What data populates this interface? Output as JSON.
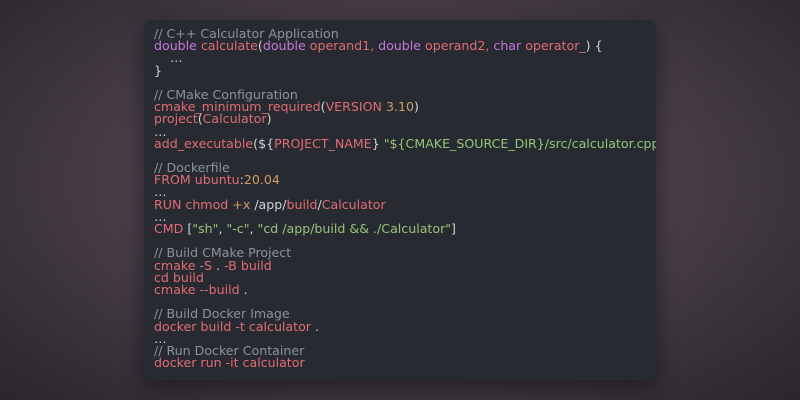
{
  "colors": {
    "comment": "#8c929c",
    "keyword": "#c678dd",
    "function": "#e06c75",
    "string": "#98c379",
    "number": "#d19a66",
    "window_bg": "#272b31"
  },
  "code": {
    "cpp": {
      "comment": "// C++ Calculator Application",
      "kw_double": "double",
      "fn_calculate": "calculate",
      "paren_open": "(",
      "kw_double2": "double",
      "param1": " operand1, ",
      "kw_double3": "double",
      "param2": " operand2, ",
      "kw_char": "char",
      "param3": " operator_",
      "close": ") {",
      "ellipsis": "    …",
      "brace_close": "}"
    },
    "cmake": {
      "comment": "// CMake Configuration",
      "fn_min": "cmake_minimum_required",
      "min_open": "(",
      "min_arg": "VERSION ",
      "min_ver": "3.10",
      "min_close": ")",
      "fn_project": "project",
      "project_open": "(",
      "project_arg": "Calculator",
      "project_close": ")",
      "ellipsis": "…",
      "fn_add": "add_executable",
      "add_open": "(${",
      "add_var": "PROJECT_NAME",
      "add_mid": "} ",
      "add_str": "\"${CMAKE_SOURCE_DIR}/src/calculator.cpp\"",
      "add_close": ")"
    },
    "docker": {
      "comment": "// Dockerfile",
      "from_kw": "FROM ",
      "from_img": "ubuntu",
      "from_colon": ":",
      "from_ver": "20.04",
      "ellipsis1": "…",
      "run_kw": "RUN ",
      "run_cmd": "chmod ",
      "run_flag": "+x ",
      "run_path1": "/app/",
      "run_path2": "build",
      "run_path3": "/",
      "run_path4": "Calculator",
      "ellipsis2": "…",
      "cmd_kw": "CMD ",
      "cmd_open": "[",
      "cmd_s1": "\"sh\"",
      "cmd_c1": ", ",
      "cmd_s2": "\"-c\"",
      "cmd_c2": ", ",
      "cmd_s3": "\"cd /app/build && ./Calculator\"",
      "cmd_close": "]"
    },
    "build_cmake": {
      "comment": "// Build CMake Project",
      "l1_cmd": "cmake ",
      "l1_flag": "-S ",
      "l1_dot": ". ",
      "l1_flag2": "-B ",
      "l1_arg": "build",
      "l2_cmd": "cd ",
      "l2_arg": "build",
      "l3_cmd": "cmake ",
      "l3_flag": "--build ",
      "l3_dot": "."
    },
    "build_docker": {
      "comment": "// Build Docker Image",
      "l1_cmd": "docker ",
      "l1_sub": "build ",
      "l1_flag": "-t ",
      "l1_arg": "calculator ",
      "l1_dot": ".",
      "ellipsis": "…"
    },
    "run_docker": {
      "comment": "// Run Docker Container",
      "l1_cmd": "docker ",
      "l1_sub": "run ",
      "l1_flag": "-it ",
      "l1_arg": "calculator"
    }
  }
}
